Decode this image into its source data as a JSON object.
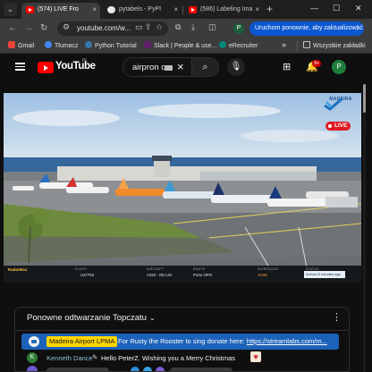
{
  "browser": {
    "tabs": [
      {
        "title": "(574) LIVE Fro",
        "icon": "youtube-favicon",
        "active": true
      },
      {
        "title": "pytabels - PyPI",
        "icon": "pypi-favicon",
        "active": false
      },
      {
        "title": "(586) Labeling Ima",
        "icon": "youtube-favicon",
        "active": false
      }
    ],
    "tab_close_glyph": "×",
    "new_tab_glyph": "+",
    "window_controls": {
      "minimize": "—",
      "maximize": "☐",
      "close": "✕"
    },
    "address": "youtube.com/w...",
    "profile_initial": "P",
    "restart_button": "Uruchom ponownie, aby zaktualizować",
    "accent_color": "#0b57d0"
  },
  "bookmarks": {
    "items": [
      {
        "label": "Gmail",
        "icon": "gmail-icon"
      },
      {
        "label": "Tłumacz",
        "icon": "translate-icon"
      },
      {
        "label": "Python Tutorial",
        "icon": "python-icon"
      },
      {
        "label": "Slack | People & use...",
        "icon": "slack-icon"
      },
      {
        "label": "eRecruiter",
        "icon": "erecruiter-icon"
      }
    ],
    "overflow": "»",
    "all_bookmarks": "Wszystkie zakładki"
  },
  "youtube": {
    "logo_text": "YouTube",
    "country_code": "PL",
    "search_query": "airpron c",
    "notification_count": "9+",
    "avatar_initial": "P",
    "brand_color": "#ff0000"
  },
  "video": {
    "channel_brand": "MADEIRA",
    "live_label": "LIVE",
    "overlay": {
      "provider": "RadarBox",
      "columns": [
        "FLIGHT",
        "AIRCRAFT",
        "ROUTE",
        "SCHEDULED",
        "STATUS"
      ],
      "flight": "U27753",
      "aircraft": "A320 - OE-LIG",
      "route": "Porto OPO",
      "time": "14:55",
      "status": "Arrived 5 minutes ago"
    }
  },
  "chat": {
    "title": "Ponowne odtwarzanie Topczatu",
    "pinned": {
      "author": "Madeira Airport LPMA",
      "message": "For Rusty the Rooster to sing donate here: https://streamlabs.com/m...",
      "link_text": "https://streamlabs.com/m...",
      "highlight_color": "#1c62b9"
    },
    "messages": [
      {
        "author": "Kenneth Dance",
        "text": "Hello PeterZ. Wishing you a Merry Christmas",
        "avatar_initial": "K"
      }
    ]
  }
}
